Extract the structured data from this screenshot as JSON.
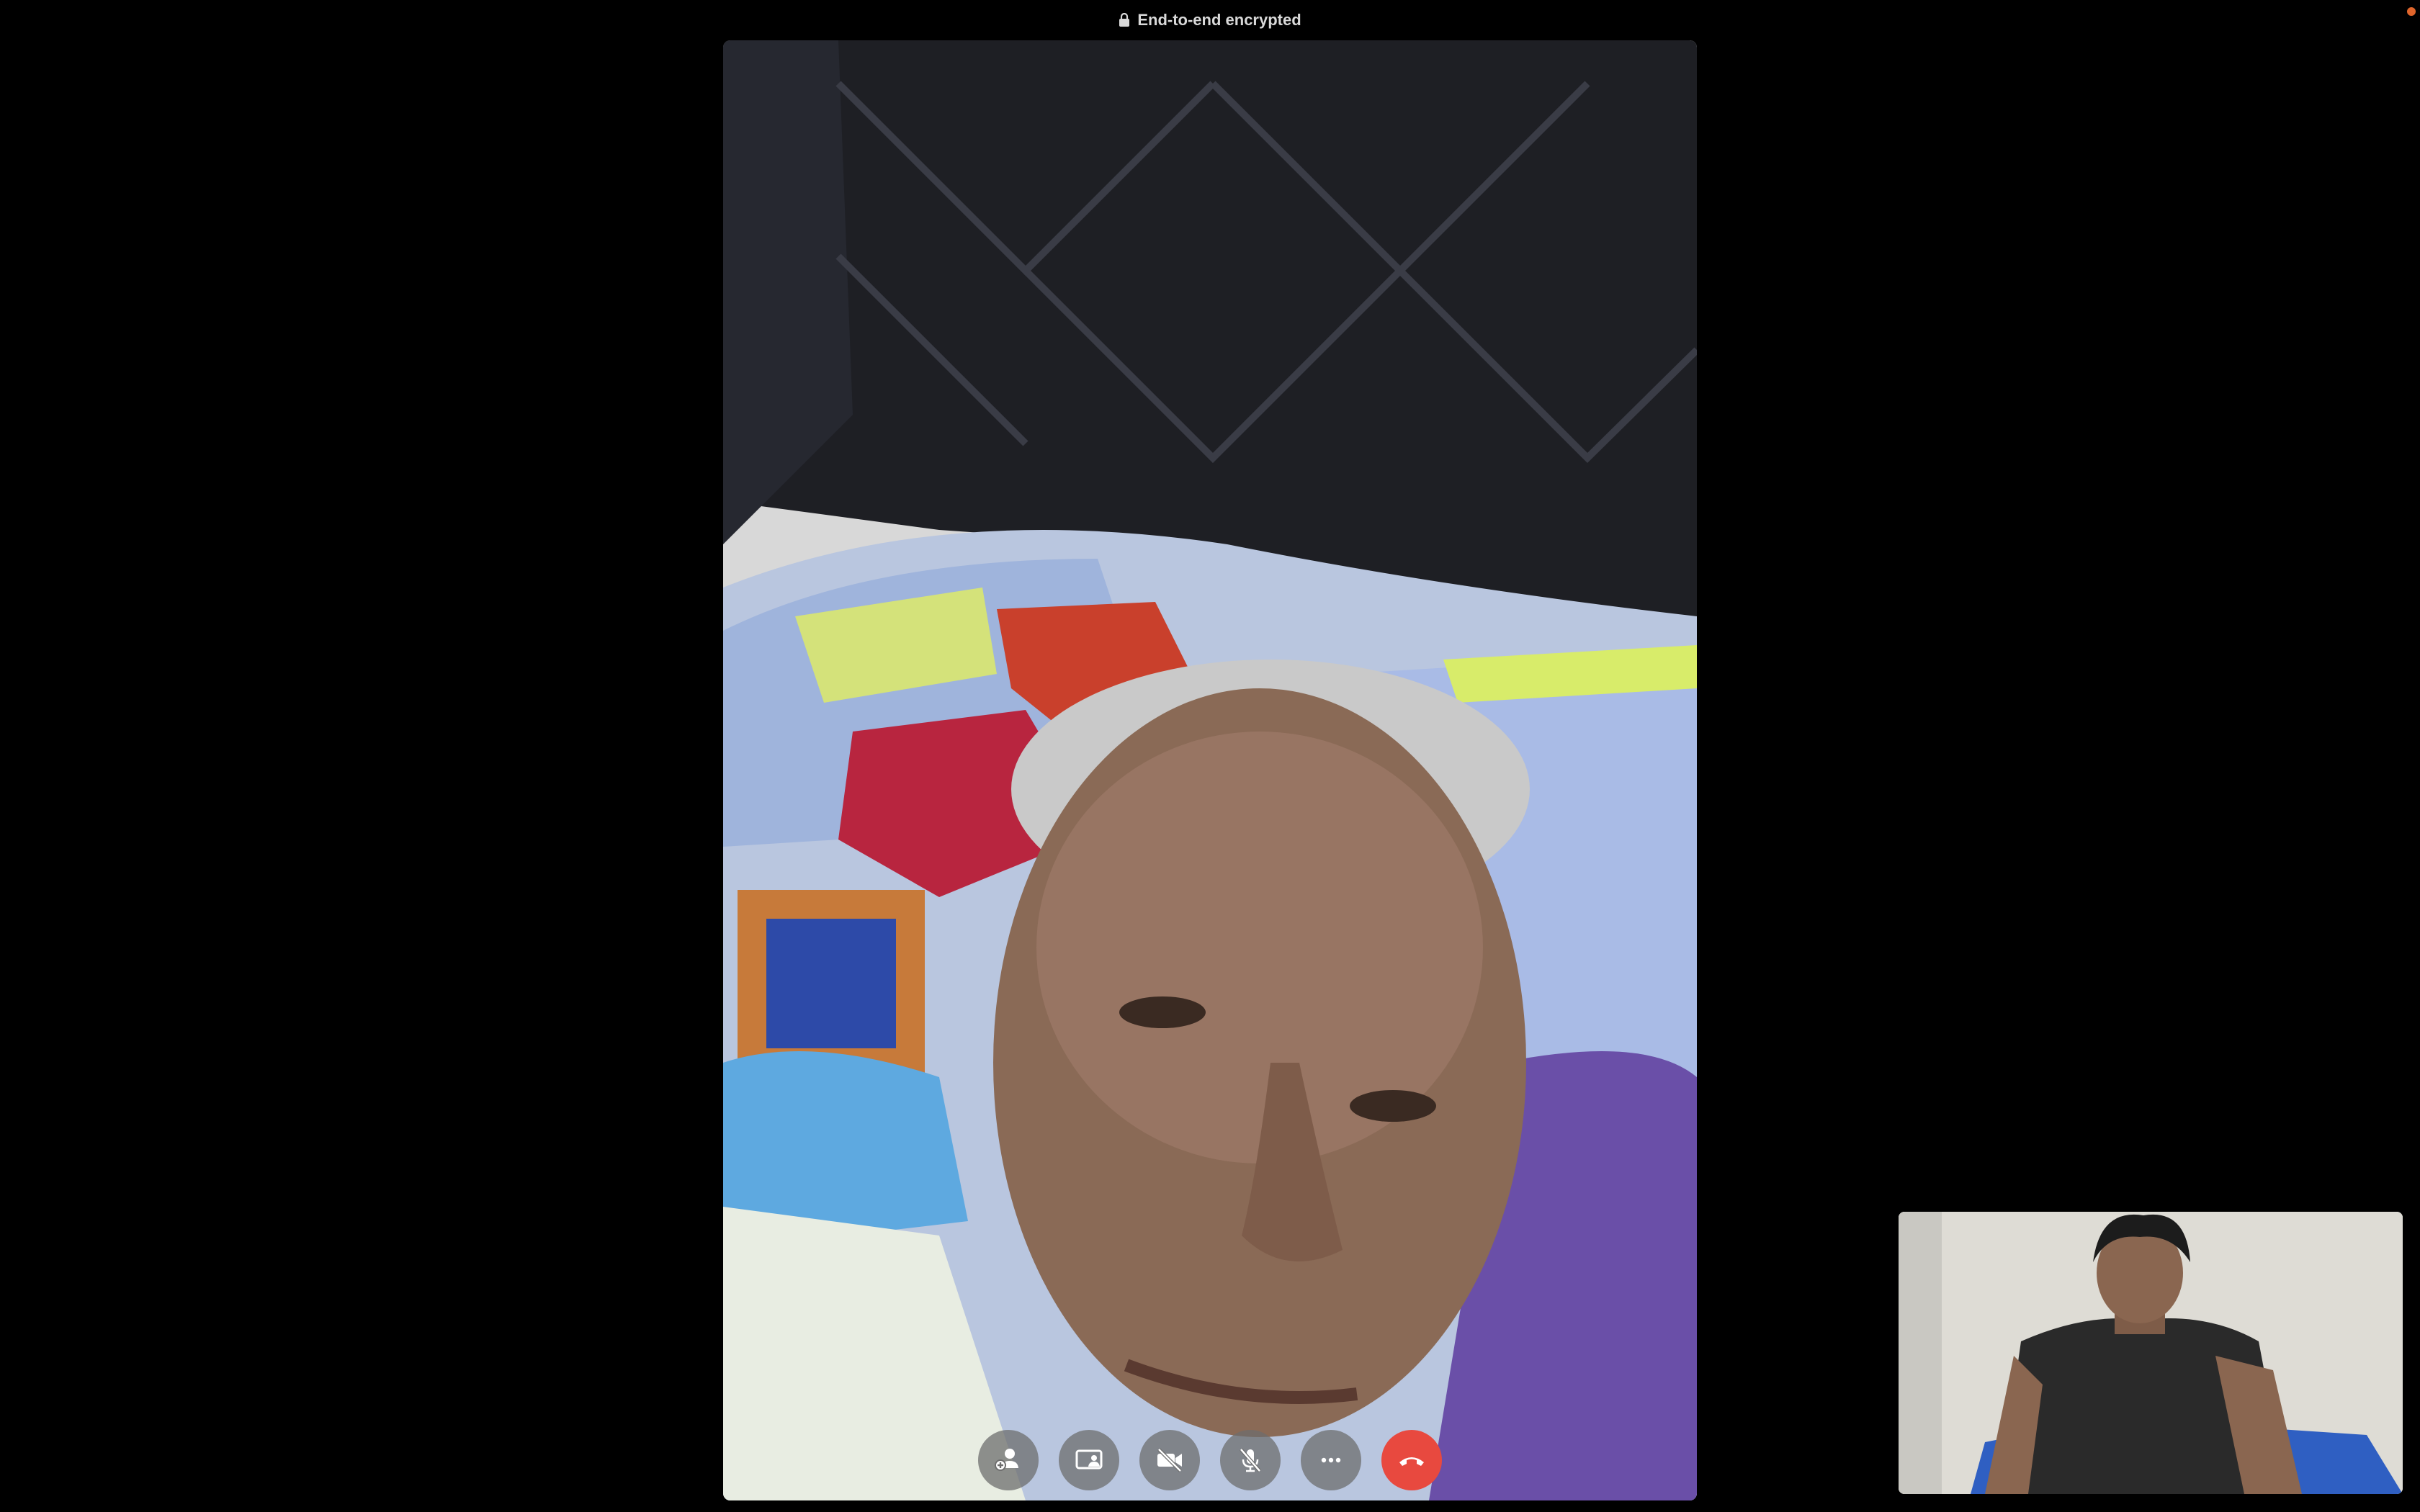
{
  "header": {
    "encryption_text": "End-to-end encrypted",
    "lock_icon": "lock-icon"
  },
  "main_video": {
    "participant": "remote-participant",
    "description_icon": "video-feed"
  },
  "self_view": {
    "icon": "self-view-video"
  },
  "controls": [
    {
      "name": "add-person-button",
      "icon": "add-person-icon"
    },
    {
      "name": "share-screen-button",
      "icon": "share-screen-icon"
    },
    {
      "name": "camera-off-button",
      "icon": "camera-off-icon"
    },
    {
      "name": "mute-button",
      "icon": "mic-off-icon"
    },
    {
      "name": "more-button",
      "icon": "ellipsis-icon"
    },
    {
      "name": "end-call-button",
      "icon": "phone-hangup-icon"
    }
  ],
  "colors": {
    "background": "#000000",
    "end_call": "#e8493f",
    "control_bg": "#6e6e6e",
    "recording_dot": "#e0652b"
  }
}
